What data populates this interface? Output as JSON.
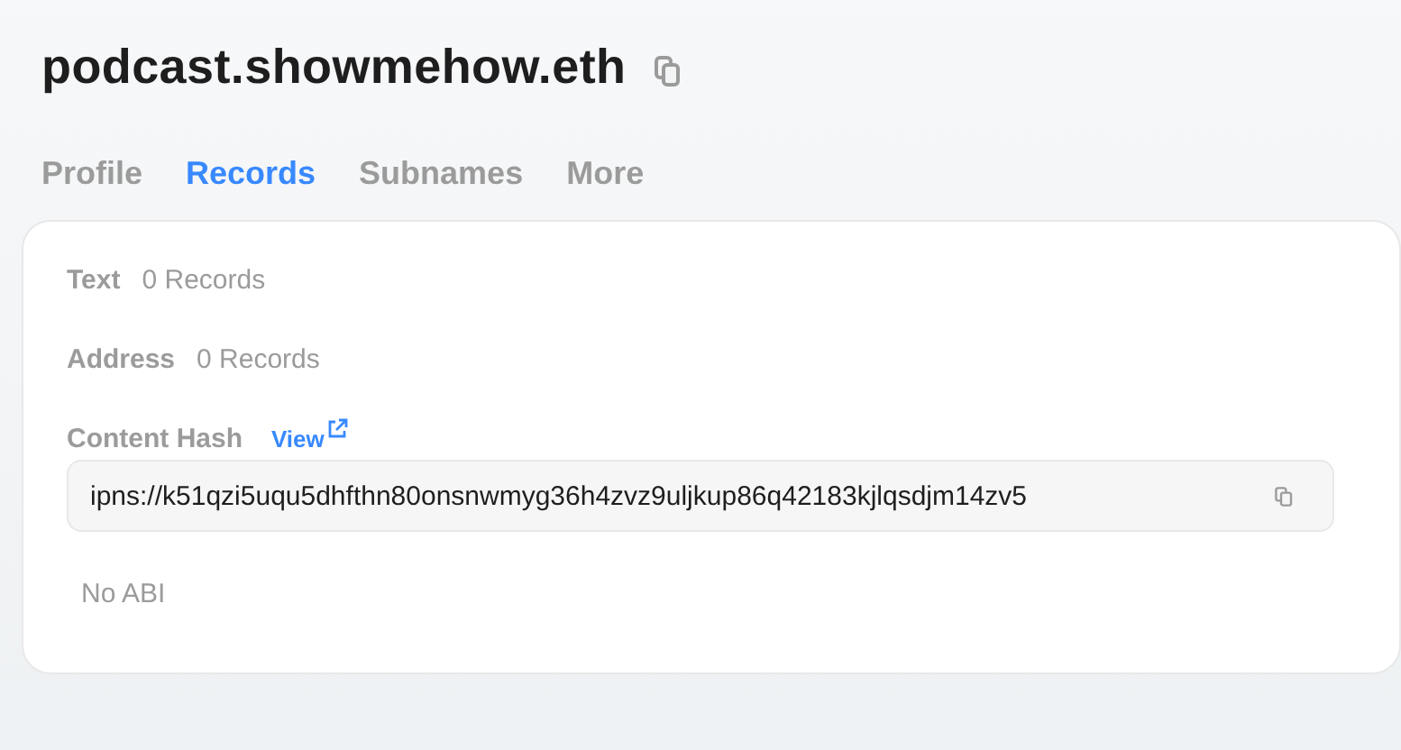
{
  "header": {
    "title": "podcast.showmehow.eth"
  },
  "tabs": [
    {
      "label": "Profile",
      "selected": false
    },
    {
      "label": "Records",
      "selected": true
    },
    {
      "label": "Subnames",
      "selected": false
    },
    {
      "label": "More",
      "selected": false
    }
  ],
  "records": [
    {
      "label": "Text",
      "value": "0 Records"
    },
    {
      "label": "Address",
      "value": "0 Records"
    }
  ],
  "content_hash": {
    "label": "Content Hash",
    "link": "View",
    "value": "ipns://k51qzi5uqu5dhfthn80onsnwmyg36h4zvz9uljkup86q42183kjlqsdjm14zv5"
  },
  "abi": {
    "text": "No ABI"
  }
}
